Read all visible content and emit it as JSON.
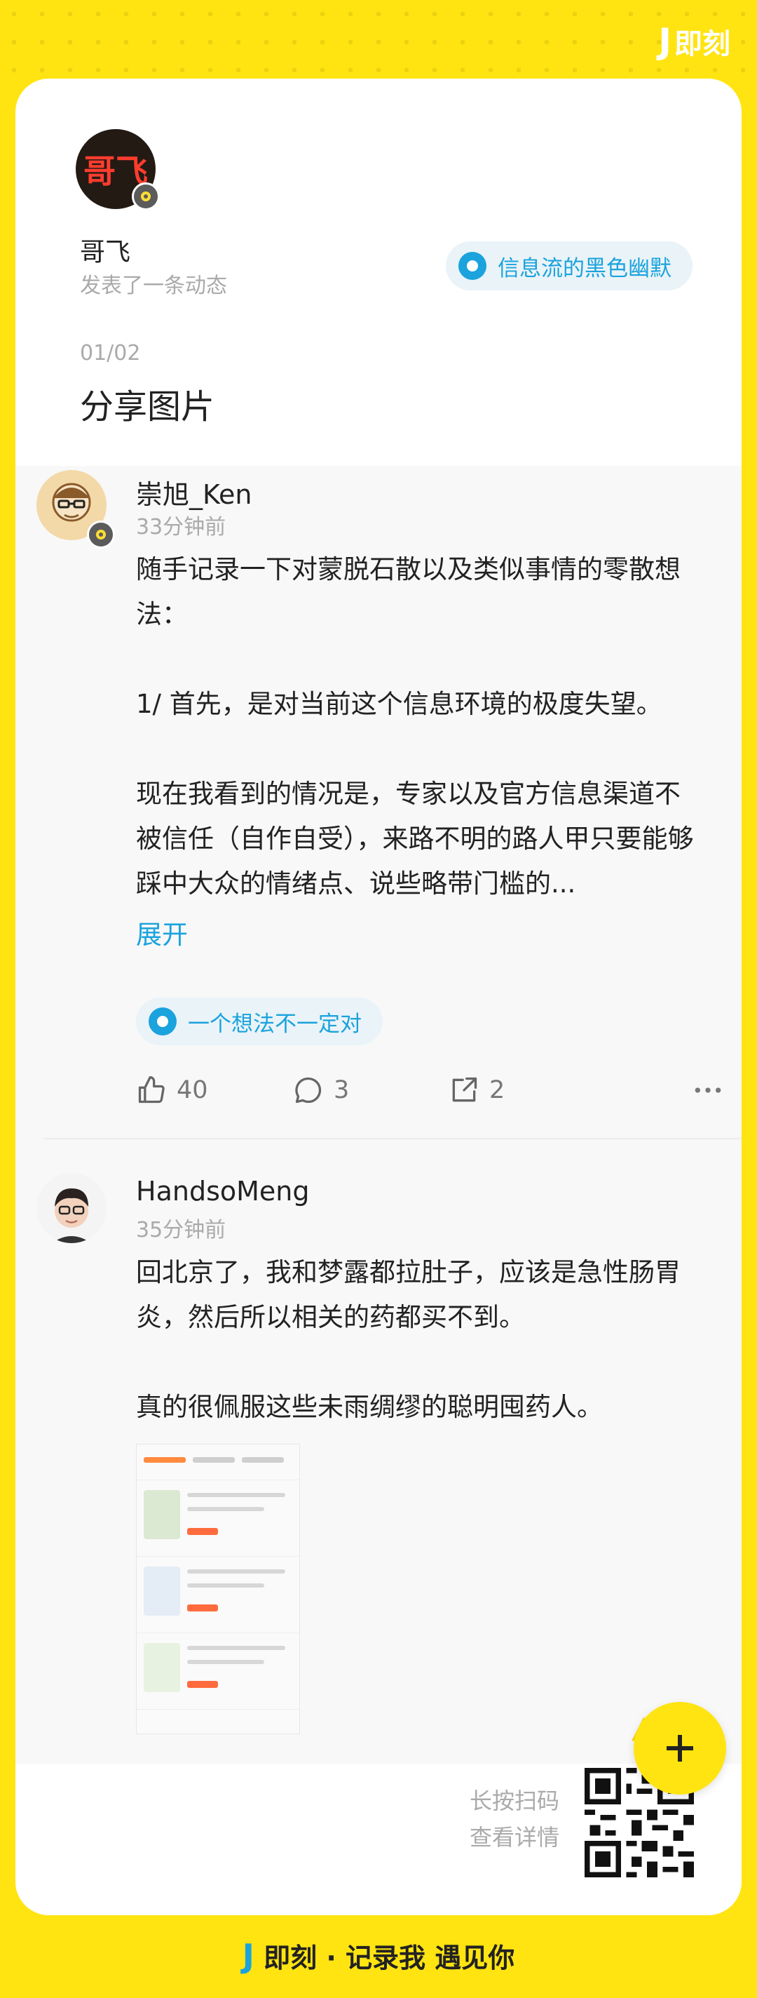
{
  "brand": {
    "mark": "J",
    "name": "即刻"
  },
  "main": {
    "avatar_text": "哥飞",
    "author": "哥飞",
    "subtitle": "发表了一条动态",
    "topic": "信息流的黑色幽默",
    "counter": "01/02",
    "title": "分享图片"
  },
  "posts": [
    {
      "user": "崇旭_Ken",
      "time": "33分钟前",
      "paragraphs": [
        "随手记录一下对蒙脱石散以及类似事情的零散想法：",
        "1/ 首先，是对当前这个信息环境的极度失望。",
        "现在我看到的情况是，专家以及官方信息渠道不被信任（自作自受），来路不明的路人甲只要能够踩中大众的情绪点、说些略带门槛的..."
      ],
      "expand": "展开",
      "topic": "一个想法不一定对",
      "likes": "40",
      "comments": "3",
      "shares": "2"
    },
    {
      "user": "HandsoMeng",
      "time": "35分钟前",
      "paragraphs": [
        "回北京了，我和梦露都拉肚子，应该是急性肠胃炎，然后所以相关的药都买不到。",
        "真的很佩服这些未雨绸缪的聪明囤药人。"
      ]
    }
  ],
  "footer": {
    "scan_line1": "长按扫码",
    "scan_line2": "查看详情",
    "slogan": "即刻 · 记录我 遇见你"
  },
  "colors": {
    "brand_yellow": "#FFE411",
    "accent_blue": "#1AA3DD"
  }
}
